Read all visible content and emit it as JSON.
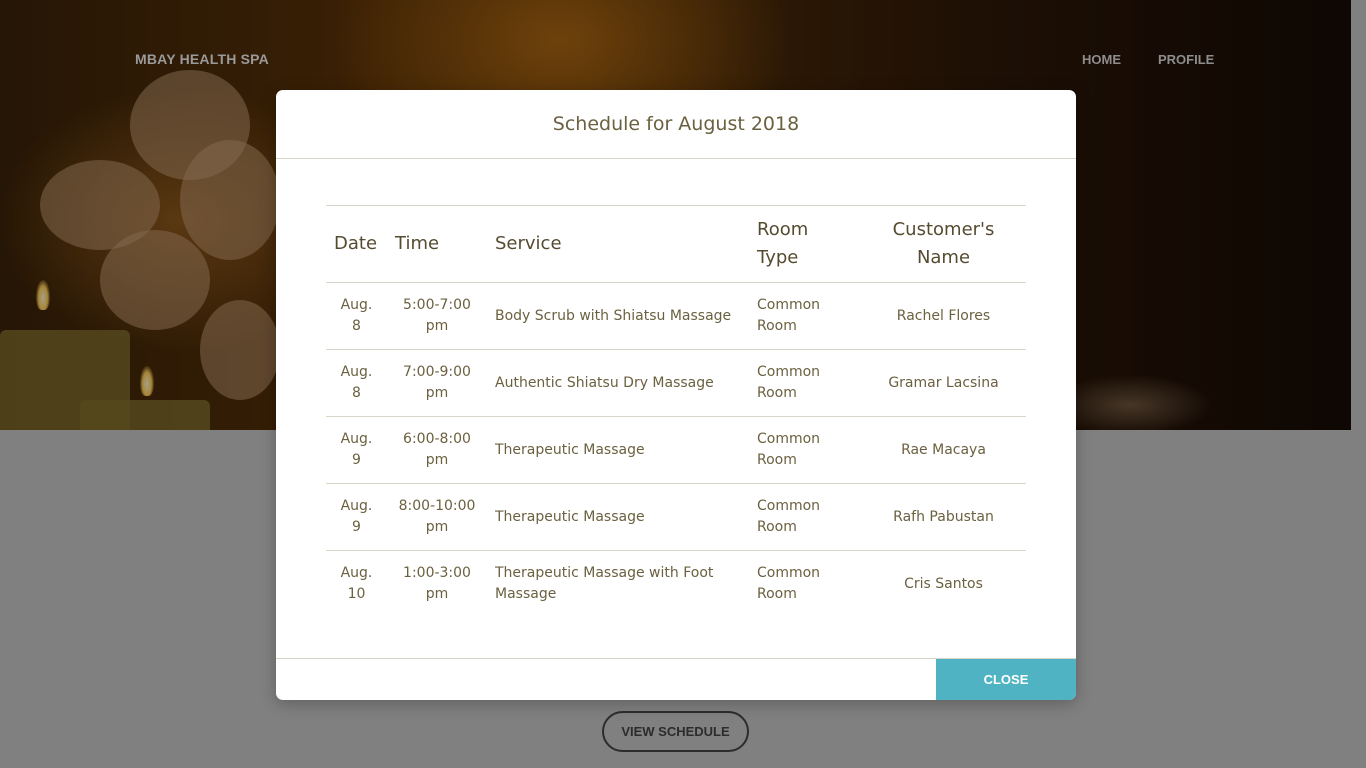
{
  "site": {
    "brand": "MBAY HEALTH SPA",
    "nav": [
      {
        "label": "HOME"
      },
      {
        "label": "PROFILE"
      }
    ],
    "view_schedule_label": "VIEW SCHEDULE"
  },
  "modal": {
    "title": "Schedule for August 2018",
    "columns": [
      "Date",
      "Time",
      "Service",
      "Room Type",
      "Customer's Name"
    ],
    "rows": [
      {
        "date": "Aug. 8",
        "time": "5:00-7:00 pm",
        "service": "Body Scrub with Shiatsu Massage",
        "room": "Common Room",
        "name": "Rachel Flores"
      },
      {
        "date": "Aug. 8",
        "time": "7:00-9:00 pm",
        "service": "Authentic Shiatsu Dry Massage",
        "room": "Common Room",
        "name": "Gramar Lacsina"
      },
      {
        "date": "Aug. 9",
        "time": "6:00-8:00 pm",
        "service": "Therapeutic Massage",
        "room": "Common Room",
        "name": "Rae Macaya"
      },
      {
        "date": "Aug. 9",
        "time": "8:00-10:00 pm",
        "service": "Therapeutic Massage",
        "room": "Common Room",
        "name": "Rafh Pabustan"
      },
      {
        "date": "Aug. 10",
        "time": "1:00-3:00 pm",
        "service": "Therapeutic Massage with Foot Massage",
        "room": "Common Room",
        "name": "Cris Santos"
      }
    ],
    "close_label": "CLOSE"
  },
  "colors": {
    "accent": "#50b3c3",
    "text": "#6b6140",
    "overlay": "#808080"
  }
}
